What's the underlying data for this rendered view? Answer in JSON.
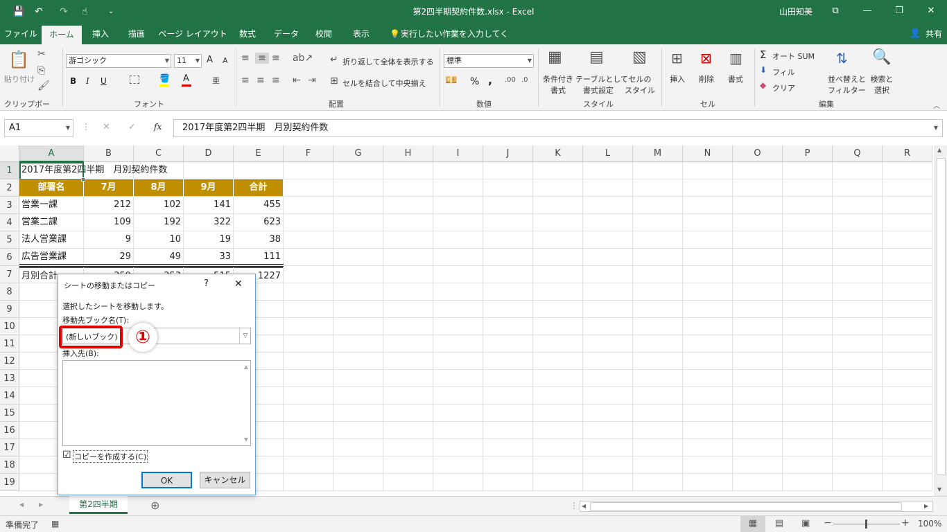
{
  "titlebar": {
    "title": "第2四半期契約件数.xlsx  -  Excel",
    "user": "山田知美",
    "save_icon": "💾",
    "undo_icon": "↶",
    "redo_icon": "↷",
    "touch_icon": "☝",
    "customize_icon": "⌄",
    "restore_icon": "⧉",
    "minimize_icon": "—",
    "maximize_icon": "❐",
    "close_icon": "✕"
  },
  "tabs": [
    "ファイル",
    "ホーム",
    "挿入",
    "描画",
    "ページ レイアウト",
    "数式",
    "データ",
    "校閲",
    "表示"
  ],
  "tell_me": "実行したい作業を入力してください",
  "share": "共有",
  "ribbon": {
    "clipboard": {
      "paste": "貼り付け",
      "label": "クリップボード"
    },
    "font": {
      "name": "游ゴシック",
      "size": "11",
      "label": "フォント",
      "bold": "B",
      "italic": "I",
      "underline": "U",
      "grow": "A",
      "shrink": "A",
      "color_a": "A"
    },
    "alignment": {
      "wrap": "折り返して全体を表示する",
      "merge": "セルを結合して中央揃え",
      "label": "配置"
    },
    "number": {
      "format": "標準",
      "label": "数値",
      "percent": "%",
      "comma": ","
    },
    "styles": {
      "conditional": [
        "条件付き",
        "書式"
      ],
      "table": [
        "テーブルとして",
        "書式設定"
      ],
      "cell": [
        "セルの",
        "スタイル"
      ],
      "label": "スタイル"
    },
    "cells": {
      "insert": "挿入",
      "delete": "削除",
      "format": "書式",
      "label": "セル"
    },
    "editing": {
      "autosum": "オート SUM",
      "fill": "フィル",
      "clear": "クリア",
      "sort": [
        "並べ替えと",
        "フィルター"
      ],
      "find": [
        "検索と",
        "選択"
      ],
      "label": "編集"
    }
  },
  "formula": {
    "namebox": "A1",
    "fx": "fx",
    "content": "2017年度第2四半期　月別契約件数"
  },
  "columns": [
    "A",
    "B",
    "C",
    "D",
    "E",
    "F",
    "G",
    "H",
    "I",
    "J",
    "K",
    "L",
    "M",
    "N",
    "O",
    "P",
    "Q",
    "R"
  ],
  "rows": [
    "1",
    "2",
    "3",
    "4",
    "5",
    "6",
    "7",
    "8",
    "9",
    "10",
    "11",
    "12",
    "13",
    "14",
    "15",
    "16",
    "17",
    "18",
    "19"
  ],
  "sheet": {
    "a1": "2017年度第2四半期　月別契約件数",
    "headers": [
      "部署名",
      "7月",
      "8月",
      "9月",
      "合計"
    ],
    "data": [
      [
        "営業一課",
        "212",
        "102",
        "141",
        "455"
      ],
      [
        "営業二課",
        "109",
        "192",
        "322",
        "623"
      ],
      [
        "法人営業課",
        "9",
        "10",
        "19",
        "38"
      ],
      [
        "広告営業課",
        "29",
        "49",
        "33",
        "111"
      ],
      [
        "月別合計",
        "359",
        "353",
        "515",
        "1227"
      ]
    ]
  },
  "dialog": {
    "title": "シートの移動またはコピー",
    "help": "?",
    "close": "✕",
    "message": "選択したシートを移動します。",
    "book_label": "移動先ブック名(T):",
    "book_value": "(新しいブック)",
    "insert_label": "挿入先(B):",
    "copy_label": "コピーを作成する(C)",
    "copy_checked": "☑",
    "ok": "OK",
    "cancel": "キャンセル",
    "callout": "①"
  },
  "sheettabs": {
    "active": "第2四半期",
    "add": "⊕"
  },
  "status": {
    "ready": "準備完了",
    "zoom": "100%"
  },
  "colors": {
    "excel_green": "#217346",
    "table_header": "#bf8f00",
    "callout_red": "#e00000"
  }
}
